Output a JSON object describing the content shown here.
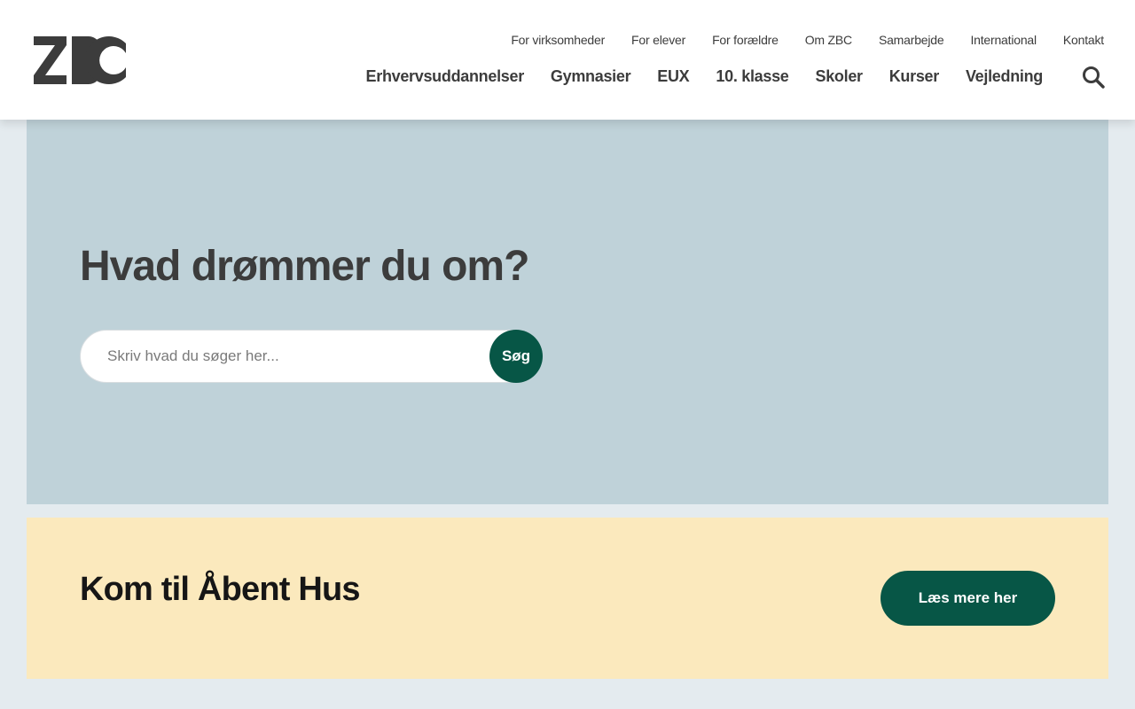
{
  "brand": {
    "logo_text": "ZBC",
    "logo_color": "#3c3c3c",
    "accent": "#075646"
  },
  "topnav": {
    "items": [
      {
        "label": "For virksomheder"
      },
      {
        "label": "For elever"
      },
      {
        "label": "For forældre"
      },
      {
        "label": "Om ZBC"
      },
      {
        "label": "Samarbejde"
      },
      {
        "label": "International"
      },
      {
        "label": "Kontakt"
      }
    ]
  },
  "mainnav": {
    "items": [
      {
        "label": "Erhvervsuddannelser"
      },
      {
        "label": "Gymnasier"
      },
      {
        "label": "EUX"
      },
      {
        "label": "10. klasse"
      },
      {
        "label": "Skoler"
      },
      {
        "label": "Kurser"
      },
      {
        "label": "Vejledning"
      }
    ],
    "search_icon": "search-icon"
  },
  "hero": {
    "title": "Hvad drømmer du om?",
    "search_placeholder": "Skriv hvad du søger her...",
    "search_value": "",
    "search_button_label": "Søg",
    "background": "#bfd2d9"
  },
  "banner": {
    "title": "Kom til Åbent Hus",
    "button_label": "Læs mere her",
    "background": "#fbe9bd"
  }
}
